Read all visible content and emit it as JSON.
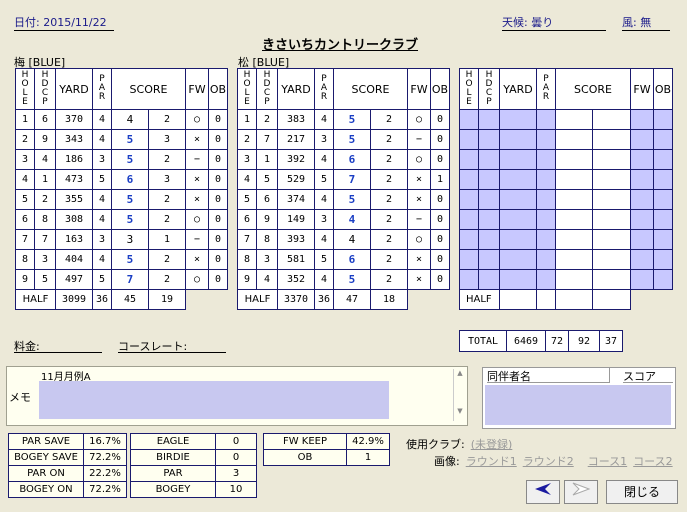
{
  "header": {
    "date_label": "日付: 2015/11/22",
    "weather_label": "天候: 曇り",
    "wind_label": "風: 無",
    "club_name": "きさいちカントリークラブ"
  },
  "course_out": {
    "label": "梅 [BLUE]",
    "holes": [
      {
        "hole": "1",
        "hdcp": "6",
        "yard": "370",
        "par": "4",
        "score": "4",
        "putt": "2",
        "fw": "○",
        "ob": "0",
        "blue": false
      },
      {
        "hole": "2",
        "hdcp": "9",
        "yard": "343",
        "par": "4",
        "score": "5",
        "putt": "3",
        "fw": "×",
        "ob": "0",
        "blue": true
      },
      {
        "hole": "3",
        "hdcp": "4",
        "yard": "186",
        "par": "3",
        "score": "5",
        "putt": "2",
        "fw": "−",
        "ob": "0",
        "blue": true
      },
      {
        "hole": "4",
        "hdcp": "1",
        "yard": "473",
        "par": "5",
        "score": "6",
        "putt": "3",
        "fw": "×",
        "ob": "0",
        "blue": true
      },
      {
        "hole": "5",
        "hdcp": "2",
        "yard": "355",
        "par": "4",
        "score": "5",
        "putt": "2",
        "fw": "×",
        "ob": "0",
        "blue": true
      },
      {
        "hole": "6",
        "hdcp": "8",
        "yard": "308",
        "par": "4",
        "score": "5",
        "putt": "2",
        "fw": "○",
        "ob": "0",
        "blue": true
      },
      {
        "hole": "7",
        "hdcp": "7",
        "yard": "163",
        "par": "3",
        "score": "3",
        "putt": "1",
        "fw": "−",
        "ob": "0",
        "blue": false
      },
      {
        "hole": "8",
        "hdcp": "3",
        "yard": "404",
        "par": "4",
        "score": "5",
        "putt": "2",
        "fw": "×",
        "ob": "0",
        "blue": true
      },
      {
        "hole": "9",
        "hdcp": "5",
        "yard": "497",
        "par": "5",
        "score": "7",
        "putt": "2",
        "fw": "○",
        "ob": "0",
        "blue": true
      }
    ],
    "half": {
      "label": "HALF",
      "yard": "3099",
      "par": "36",
      "score": "45",
      "putt": "19"
    }
  },
  "course_in": {
    "label": "松 [BLUE]",
    "holes": [
      {
        "hole": "1",
        "hdcp": "2",
        "yard": "383",
        "par": "4",
        "score": "5",
        "putt": "2",
        "fw": "○",
        "ob": "0",
        "blue": true
      },
      {
        "hole": "2",
        "hdcp": "7",
        "yard": "217",
        "par": "3",
        "score": "5",
        "putt": "2",
        "fw": "−",
        "ob": "0",
        "blue": true
      },
      {
        "hole": "3",
        "hdcp": "1",
        "yard": "392",
        "par": "4",
        "score": "6",
        "putt": "2",
        "fw": "○",
        "ob": "0",
        "blue": true
      },
      {
        "hole": "4",
        "hdcp": "5",
        "yard": "529",
        "par": "5",
        "score": "7",
        "putt": "2",
        "fw": "×",
        "ob": "1",
        "blue": true
      },
      {
        "hole": "5",
        "hdcp": "6",
        "yard": "374",
        "par": "4",
        "score": "5",
        "putt": "2",
        "fw": "×",
        "ob": "0",
        "blue": true
      },
      {
        "hole": "6",
        "hdcp": "9",
        "yard": "149",
        "par": "3",
        "score": "4",
        "putt": "2",
        "fw": "−",
        "ob": "0",
        "blue": true
      },
      {
        "hole": "7",
        "hdcp": "8",
        "yard": "393",
        "par": "4",
        "score": "4",
        "putt": "2",
        "fw": "○",
        "ob": "0",
        "blue": false
      },
      {
        "hole": "8",
        "hdcp": "3",
        "yard": "581",
        "par": "5",
        "score": "6",
        "putt": "2",
        "fw": "×",
        "ob": "0",
        "blue": true
      },
      {
        "hole": "9",
        "hdcp": "4",
        "yard": "352",
        "par": "4",
        "score": "5",
        "putt": "2",
        "fw": "×",
        "ob": "0",
        "blue": true
      }
    ],
    "half": {
      "label": "HALF",
      "yard": "3370",
      "par": "36",
      "score": "47",
      "putt": "18"
    }
  },
  "columns": {
    "hole": "HOLE",
    "hdcp": "HDCP",
    "yard": "YARD",
    "par": "PAR",
    "score": "SCORE",
    "fw": "FW",
    "ob": "OB"
  },
  "third": {
    "half_label": "HALF"
  },
  "total": {
    "label": "TOTAL",
    "yard": "6469",
    "par": "72",
    "score": "92",
    "putt": "37"
  },
  "fees": {
    "fee_label": "料金:",
    "rate_label": "コースレート:"
  },
  "memo": {
    "label": "メモ",
    "title": "11月月例A"
  },
  "companions": {
    "name_header": "同伴者名",
    "score_header": "スコア"
  },
  "stats1": [
    {
      "label": "PAR SAVE",
      "value": "16.7%"
    },
    {
      "label": "BOGEY SAVE",
      "value": "72.2%"
    },
    {
      "label": "PAR ON",
      "value": "22.2%"
    },
    {
      "label": "BOGEY ON",
      "value": "72.2%"
    }
  ],
  "stats2": [
    {
      "label": "EAGLE",
      "value": "0"
    },
    {
      "label": "BIRDIE",
      "value": "0"
    },
    {
      "label": "PAR",
      "value": "3"
    },
    {
      "label": "BOGEY",
      "value": "10"
    }
  ],
  "stats3": [
    {
      "label": "FW KEEP",
      "value": "42.9%"
    },
    {
      "label": "OB",
      "value": "1"
    }
  ],
  "clubs": {
    "used_label": "使用クラブ:",
    "unregistered": "(未登録)",
    "image_label": "画像:",
    "round1": "ラウンド1",
    "round2": "ラウンド2",
    "course1": "コース1",
    "course2": "コース2"
  },
  "buttons": {
    "close": "閉じる",
    "prev_icon": "arrow-left-icon",
    "next_icon": "arrow-right-icon"
  },
  "colors": {
    "score_blue": "#1a3ec4",
    "memo_fill": "#c8c8f0",
    "grid": "#1a1a6e"
  }
}
